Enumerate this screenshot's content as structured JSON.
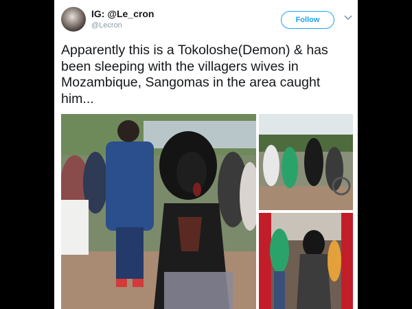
{
  "tweet": {
    "display_name": "IG: @Le_cron",
    "handle": "@Lecron",
    "follow_label": "Follow",
    "text": "Apparently this is a Tokoloshe(Demon) & has been sleeping with the villagers wives in Mozambique, Sangomas in the area caught him..."
  },
  "icons": {
    "more": "chevron-down-icon",
    "avatar": "avatar"
  },
  "colors": {
    "accent": "#1da1f2",
    "text": "#14171a",
    "secondary": "#8899a6",
    "frame": "#000000"
  },
  "media": {
    "photo_count": 3
  }
}
